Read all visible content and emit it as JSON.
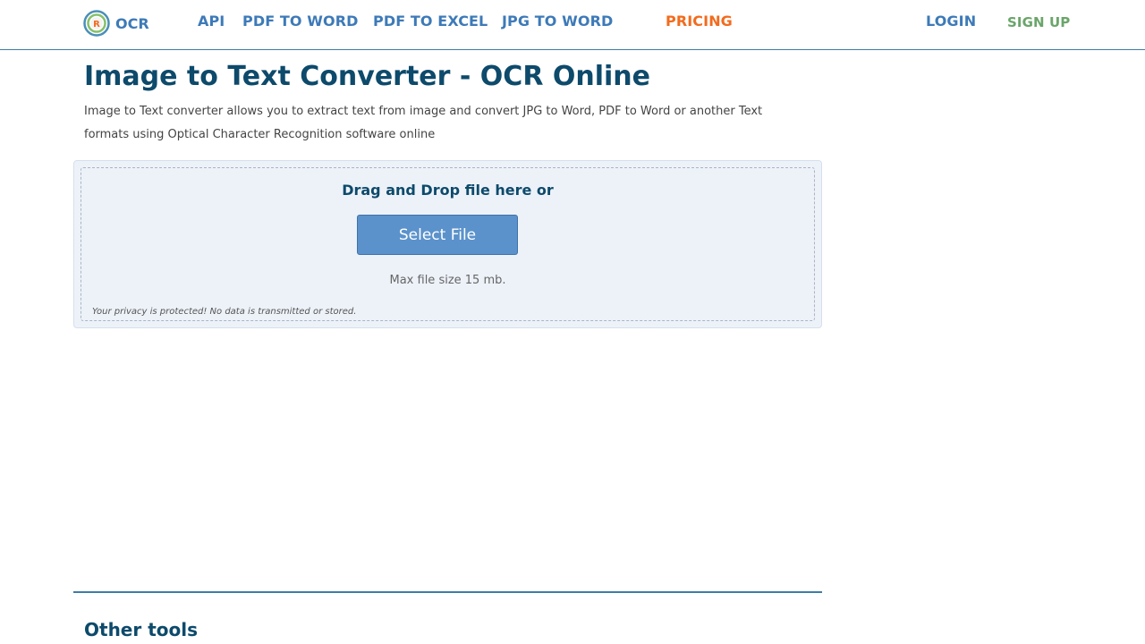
{
  "header": {
    "logo_text": "OCR",
    "nav": {
      "api": "API",
      "pdf_to_word": "PDF TO WORD",
      "pdf_to_excel": "PDF TO EXCEL",
      "jpg_to_word": "JPG TO WORD",
      "pricing": "PRICING",
      "login": "LOGIN",
      "signup": "SIGN UP"
    },
    "logo_icon": "ocr-logo-icon"
  },
  "main": {
    "title": "Image to Text Converter - OCR Online",
    "description": "Image to Text converter allows you to extract text from image and convert JPG to Word, PDF to Word or another Text formats using Optical Character Recognition software online"
  },
  "upload": {
    "drop_label": "Drag and Drop file here or",
    "select_button": "Select File",
    "max_size": "Max file size 15 mb.",
    "privacy_note": "Your privacy is protected! No data is transmitted or stored."
  },
  "other_tools": {
    "heading": "Other tools"
  },
  "colors": {
    "nav_link": "#3d7ab8",
    "pricing": "#f26b1d",
    "signup": "#6aa56a",
    "heading": "#0d4a6b",
    "button": "#5b92cb",
    "upload_bg": "#edf2f9"
  }
}
